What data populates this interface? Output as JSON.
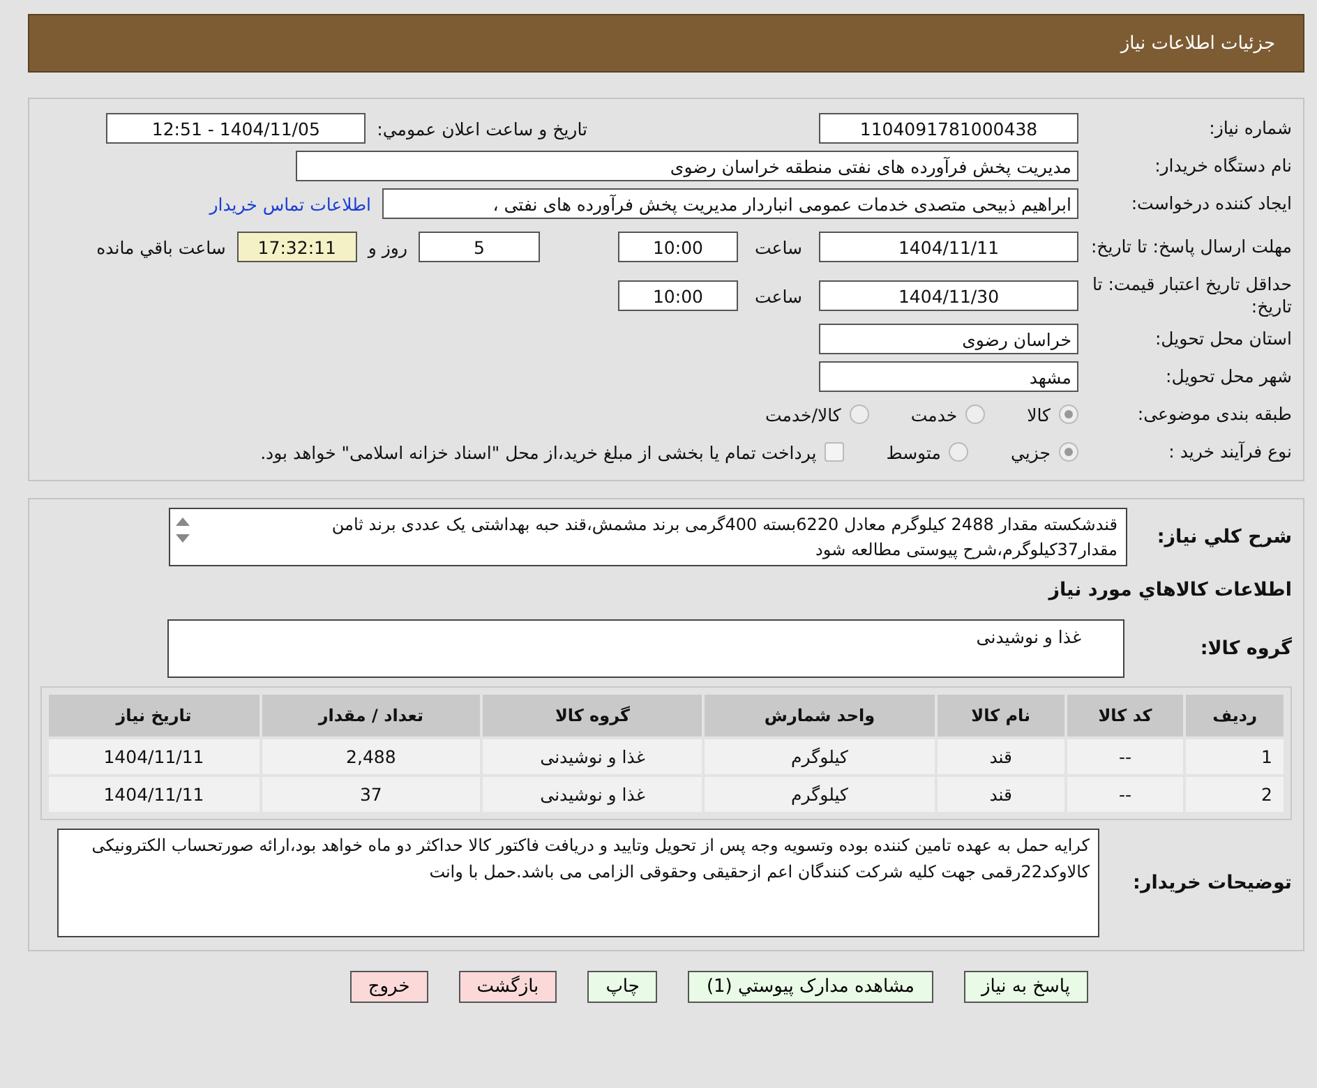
{
  "header": {
    "title": "جزئیات اطلاعات نیاز"
  },
  "need_number": {
    "label": "شماره نیاز:",
    "value": "1104091781000438"
  },
  "announce": {
    "label": "تاریخ و ساعت اعلان عمومي:",
    "value": "1404/11/05 - 12:51"
  },
  "buyer": {
    "label": "نام دستگاه خریدار:",
    "value": "مدیریت پخش فرآورده های نفتی منطقه خراسان رضوی"
  },
  "creator": {
    "label": "ایجاد کننده درخواست:",
    "value": "ابراهیم ذبیحی متصدی خدمات عمومی انباردار مدیریت پخش فرآورده های نفتی ،",
    "link": "اطلاعات تماس خریدار"
  },
  "deadline": {
    "label": "مهلت ارسال پاسخ: تا تاریخ:",
    "date": "1404/11/11",
    "time_label": "ساعت",
    "time": "10:00",
    "days": "5",
    "days_label": "روز و",
    "remaining": "17:32:11",
    "remaining_label": "ساعت باقي مانده"
  },
  "validity": {
    "label": "حداقل تاریخ اعتبار قیمت: تا تاریخ:",
    "date": "1404/11/30",
    "time_label": "ساعت",
    "time": "10:00"
  },
  "province": {
    "label": "استان محل تحویل:",
    "value": "خراسان رضوی"
  },
  "city": {
    "label": "شهر محل تحویل:",
    "value": "مشهد"
  },
  "category": {
    "label": "طبقه بندی موضوعی:",
    "options": [
      {
        "label": "کالا",
        "selected": true
      },
      {
        "label": "خدمت",
        "selected": false
      },
      {
        "label": "کالا/خدمت",
        "selected": false
      }
    ]
  },
  "process": {
    "label": "نوع فرآیند خرید :",
    "options": [
      {
        "label": "جزيي",
        "selected": true
      },
      {
        "label": "متوسط",
        "selected": false
      }
    ],
    "payment": {
      "label": "پرداخت تمام یا بخشی از مبلغ خرید،از محل \"اسناد خزانه اسلامی\" خواهد بود.",
      "checked": false
    }
  },
  "description": {
    "label": "شرح کلي نیاز:",
    "value": "قندشکسته مقدار 2488 کیلوگرم  معادل 6220بسته 400گرمی برند مشمش،قند حبه بهداشتی یک عددی برند  ثامن مقدار37کیلوگرم،شرح پیوستی مطالعه شود"
  },
  "items_heading": "اطلاعات کالاهاي مورد نیاز",
  "goods_group": {
    "label": "گروه کالا:",
    "value": "غذا و نوشیدنی"
  },
  "table": {
    "columns": [
      "ردیف",
      "کد کالا",
      "نام کالا",
      "واحد شمارش",
      "گروه کالا",
      "تعداد / مقدار",
      "تاریخ نیاز"
    ],
    "rows": [
      [
        "1",
        "--",
        "قند",
        "کیلوگرم",
        "غذا و نوشیدنی",
        "2,488",
        "1404/11/11"
      ],
      [
        "2",
        "--",
        "قند",
        "کیلوگرم",
        "غذا و نوشیدنی",
        "37",
        "1404/11/11"
      ]
    ]
  },
  "notes": {
    "label": "توضیحات خریدار:",
    "value": "کرایه حمل به عهده تامین کننده بوده وتسویه وجه پس از تحویل وتایید و دریافت فاکتور کالا حداکثر دو ماه خواهد بود،ارائه صورتحساب الکترونیکی کالاوکد22رقمی جهت کلیه شرکت کنندگان اعم ازحقیقی وحقوقی الزامی می باشد.حمل با وانت"
  },
  "buttons": [
    {
      "label": "پاسخ به نیاز",
      "kind": "action"
    },
    {
      "label": "مشاهده مدارک پیوستي (1)",
      "kind": "action"
    },
    {
      "label": "چاپ",
      "kind": "action"
    },
    {
      "label": "بازگشت",
      "kind": "exit"
    },
    {
      "label": "خروج",
      "kind": "exit"
    }
  ]
}
